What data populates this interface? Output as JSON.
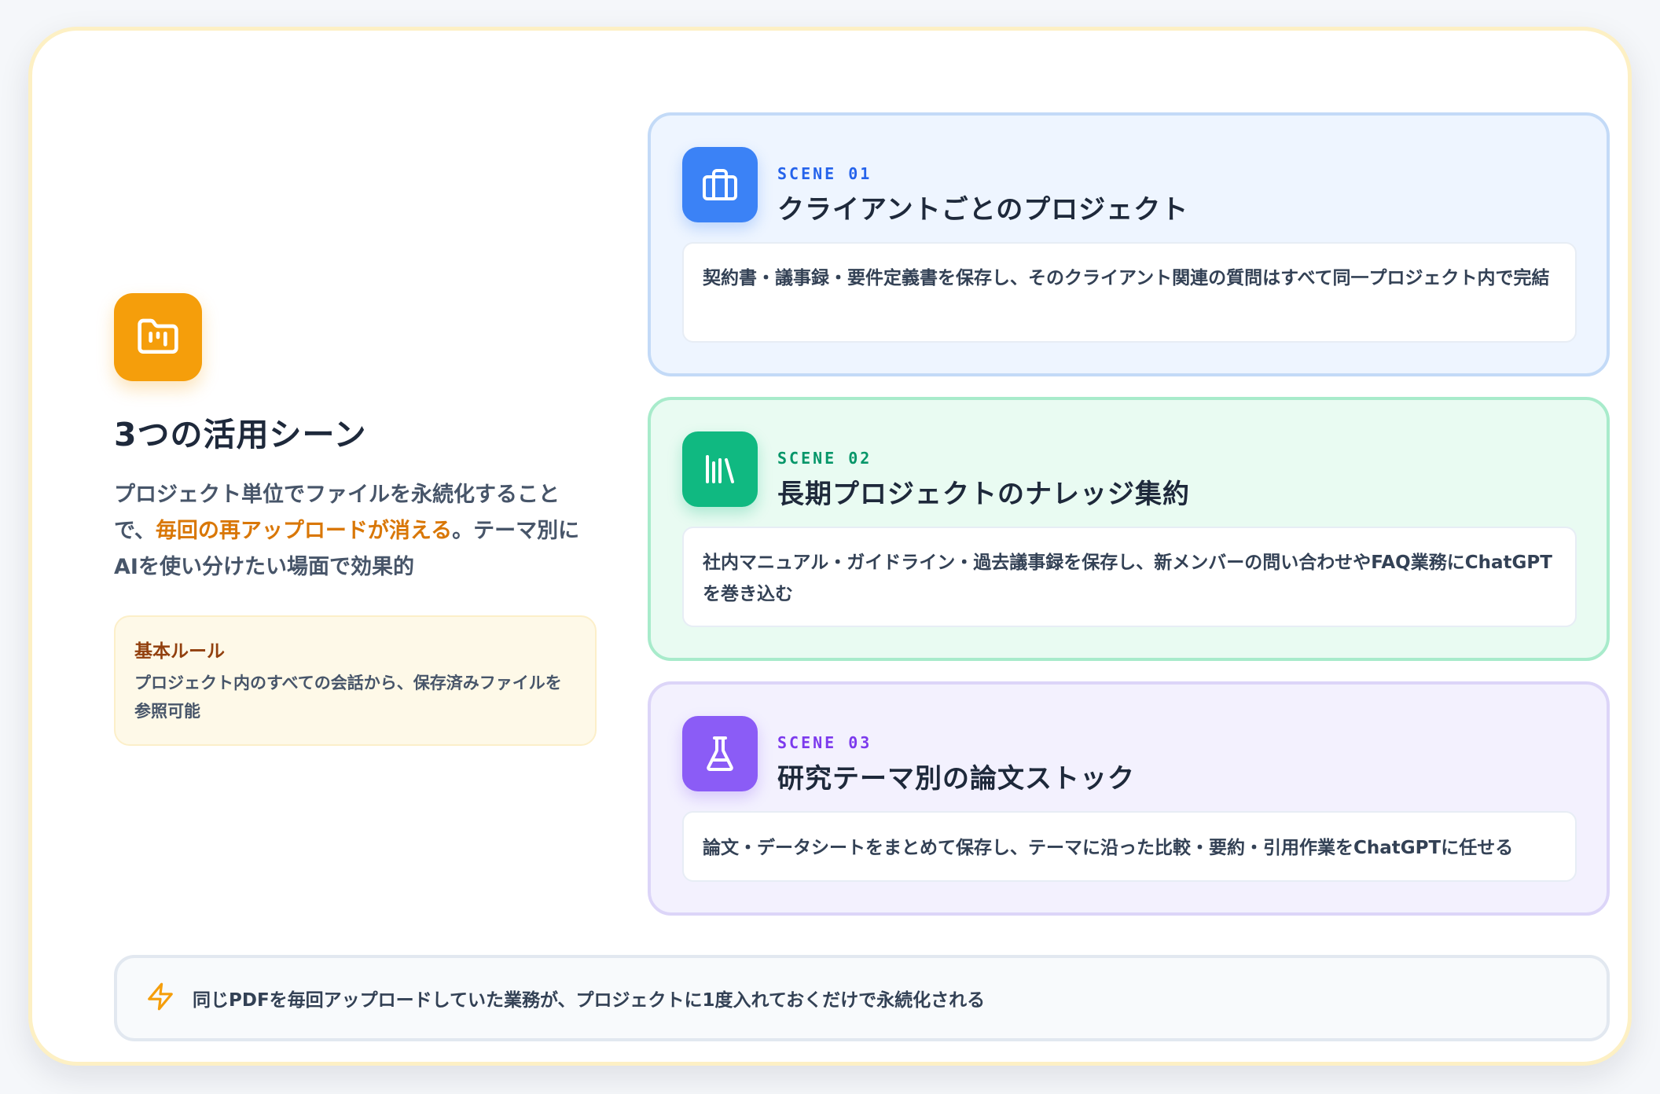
{
  "hero": {
    "icon": "folder-chart-icon",
    "title": "3つの活用シーン",
    "desc_before": "プロジェクト単位でファイルを永続化することで、",
    "desc_highlight": "毎回の再アップロードが消える",
    "desc_after": "。テーマ別にAIを使い分けたい場面で効果的",
    "highlight_color": "#d97706"
  },
  "rule": {
    "title": "基本ルール",
    "text": "プロジェクト内のすべての会話から、保存済みファイルを参照可能"
  },
  "scenes": [
    {
      "tag": "SCENE 01",
      "icon": "briefcase-icon",
      "color": "#3b82f6",
      "title": "クライアントごとのプロジェクト",
      "body": "契約書・議事録・要件定義書を保存し、そのクライアント関連の質問はすべて同一プロジェクト内で完結"
    },
    {
      "tag": "SCENE 02",
      "icon": "library-icon",
      "color": "#10b981",
      "title": "長期プロジェクトのナレッジ集約",
      "body": "社内マニュアル・ガイドライン・過去議事録を保存し、新メンバーの問い合わせやFAQ業務にChatGPTを巻き込む"
    },
    {
      "tag": "SCENE 03",
      "icon": "flask-icon",
      "color": "#8b5cf6",
      "title": "研究テーマ別の論文ストック",
      "body": "論文・データシートをまとめて保存し、テーマに沿った比較・要約・引用作業をChatGPTに任せる"
    }
  ],
  "note": {
    "icon": "lightning-icon",
    "text": "同じPDFを毎回アップロードしていた業務が、プロジェクトに1度入れておくだけで永続化される"
  }
}
